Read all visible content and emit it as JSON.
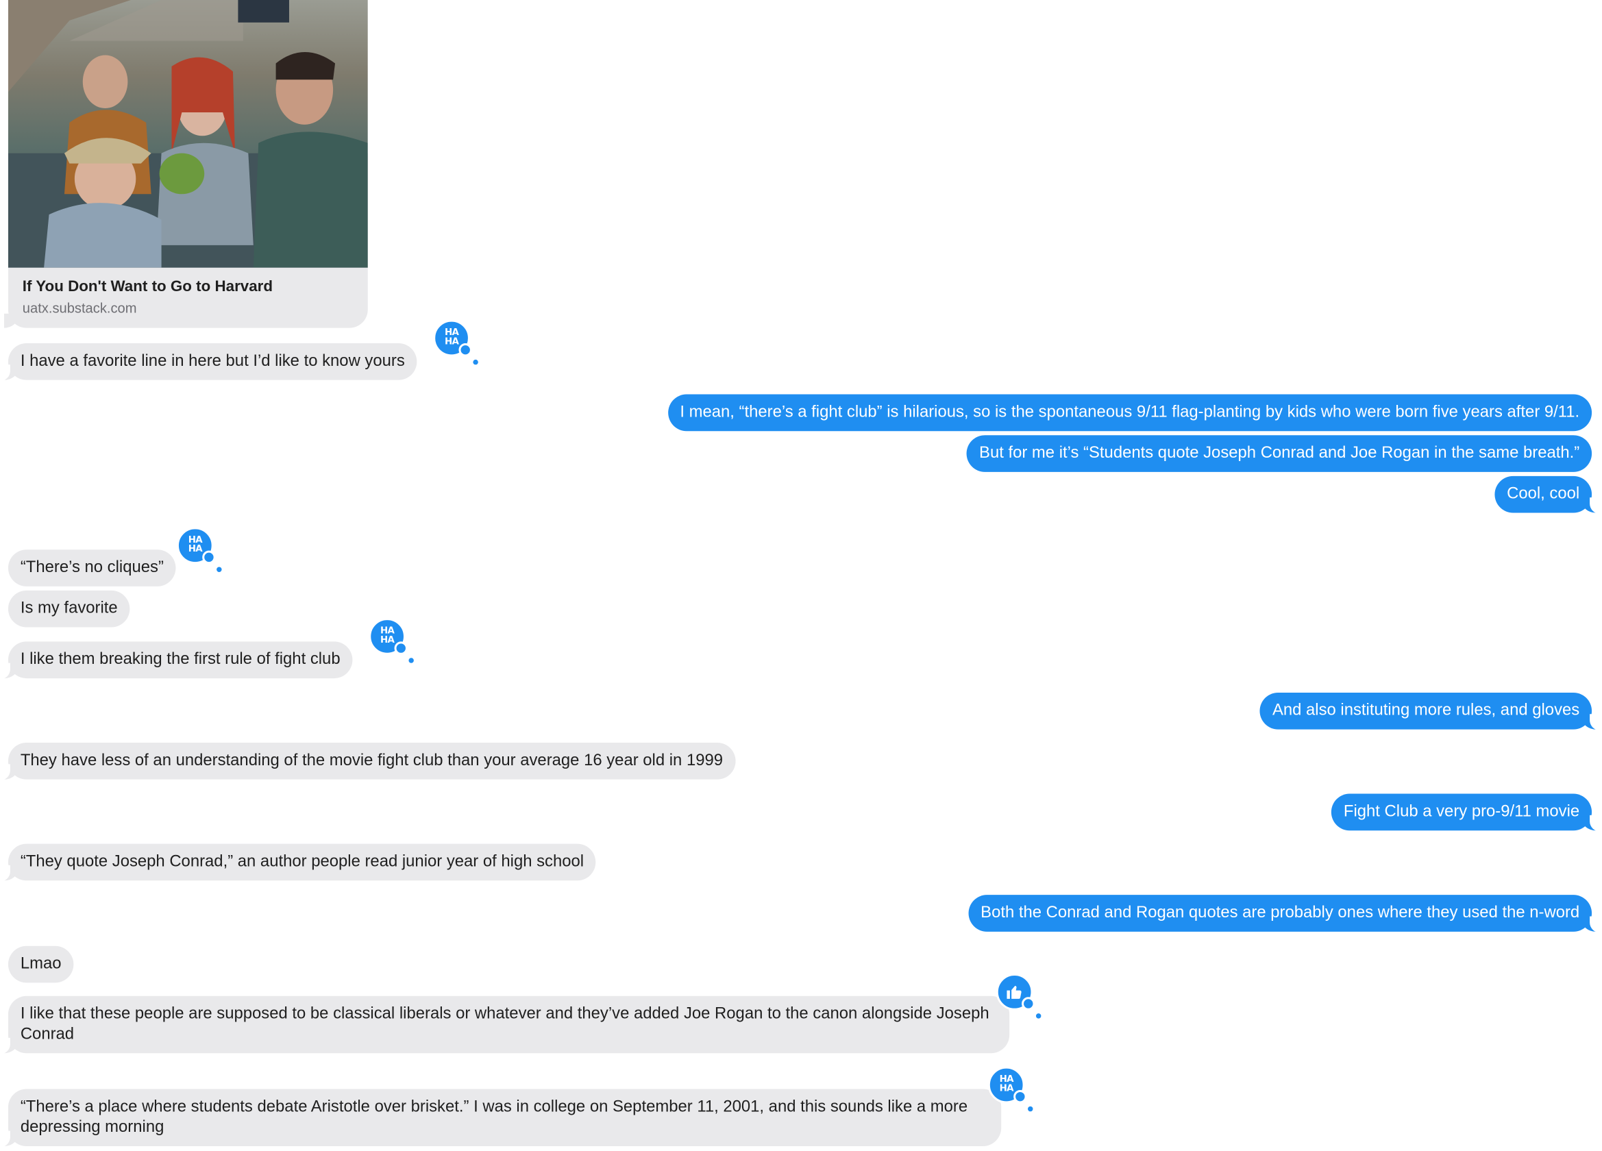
{
  "link_preview": {
    "title": "If You Don't Want to Go to Harvard",
    "domain": "uatx.substack.com"
  },
  "messages": [
    {
      "side": "in",
      "text": "I have a favorite line in here but I’d like to know yours",
      "tapback": "haha"
    },
    {
      "side": "out",
      "text": "I mean, “there’s a fight club” is hilarious, so is the spontaneous 9/11 flag-planting by kids who were born five years after 9/11."
    },
    {
      "side": "out",
      "text": "But for me it’s “Students quote Joseph Conrad and Joe Rogan in the same breath.”"
    },
    {
      "side": "out",
      "text": "Cool, cool"
    },
    {
      "side": "in",
      "text": "“There’s no cliques”",
      "tapback": "haha"
    },
    {
      "side": "in",
      "text": "Is my favorite"
    },
    {
      "side": "in",
      "text": "I like them breaking the first rule of fight club",
      "tapback": "haha"
    },
    {
      "side": "out",
      "text": "And also instituting more rules, and gloves"
    },
    {
      "side": "in",
      "text": "They have less of an understanding of the movie fight club than your average 16 year old in 1999"
    },
    {
      "side": "out",
      "text": "Fight Club a very pro-9/11 movie"
    },
    {
      "side": "in",
      "text": "“They quote Joseph Conrad,” an author people read junior year of high school"
    },
    {
      "side": "out",
      "text": "Both the Conrad and Rogan quotes are probably ones where they used the n-word"
    },
    {
      "side": "in",
      "text": "Lmao"
    },
    {
      "side": "in",
      "text": "I like that these people are supposed to be classical liberals or whatever and they’ve added Joe Rogan to the canon alongside Joseph Conrad",
      "tapback": "like"
    },
    {
      "side": "in",
      "text": "“There’s a place where students debate Aristotle over brisket.” I was in college on September 11, 2001, and this sounds like a more depressing morning",
      "tapback": "haha"
    }
  ],
  "tapback_labels": {
    "haha_top": "HA",
    "haha_bottom": "HA"
  },
  "colors": {
    "outgoing": "#1f8ef1",
    "incoming": "#e9e9eb",
    "tapback": "#1f8ef1"
  }
}
